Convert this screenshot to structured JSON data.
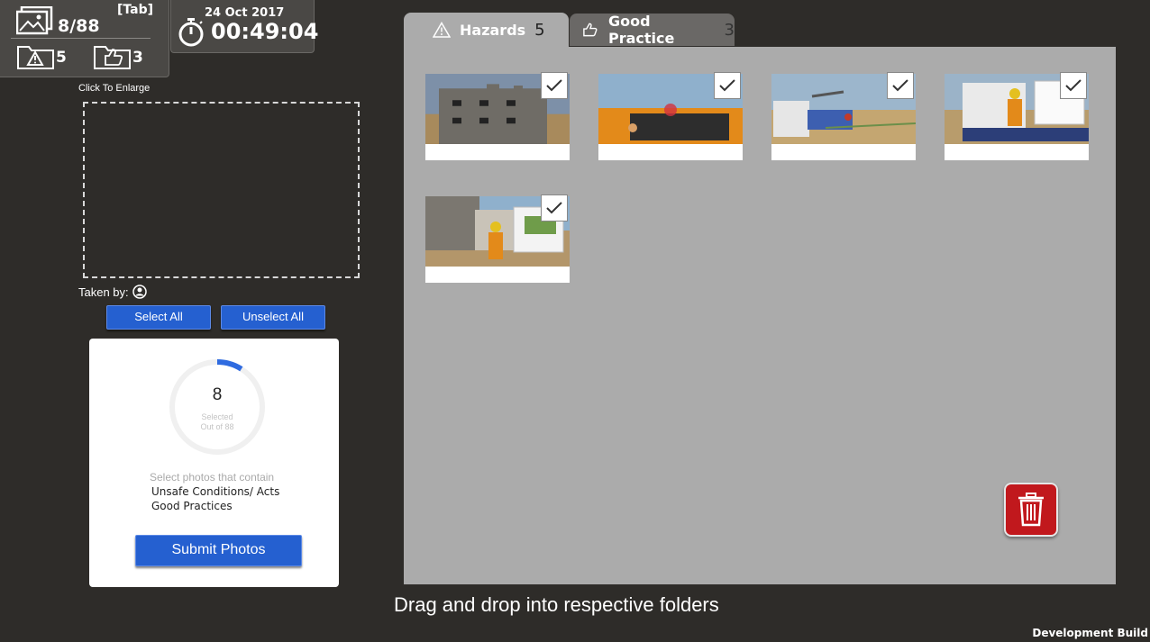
{
  "hud": {
    "photos_count": "8/88",
    "tab_hint": "[Tab]",
    "hazard_folder_count": "5",
    "good_folder_count": "3",
    "date": "24 Oct 2017",
    "timer": "00:49:04"
  },
  "left": {
    "enlarge_label": "Click To Enlarge",
    "taken_by_label": "Taken by:",
    "select_all": "Select All",
    "unselect_all": "Unselect All"
  },
  "card": {
    "selected_count": "8",
    "selected_label": "Selected",
    "out_of_label": "Out of 88",
    "progress_fraction": 0.09,
    "instruction": "Select photos that contain",
    "item1": "Unsafe Conditions/ Acts",
    "item2": "Good Practices",
    "submit": "Submit Photos"
  },
  "tabs": [
    {
      "label": "Hazards",
      "count": "5",
      "icon": "warning-icon",
      "active": true
    },
    {
      "label": "Good Practice",
      "count": "3",
      "icon": "thumbs-up-icon",
      "active": false
    }
  ],
  "photos": [
    {
      "name": "building-structure",
      "checked": true
    },
    {
      "name": "orange-vehicle",
      "checked": true
    },
    {
      "name": "truck-crane-worker",
      "checked": true
    },
    {
      "name": "truck-worker-notice",
      "checked": true
    },
    {
      "name": "worker-notice-board",
      "checked": true
    }
  ],
  "footer": {
    "instruction": "Drag and drop into respective folders",
    "dev_build": "Development Build"
  },
  "colors": {
    "background": "#2e2c29",
    "accent_blue": "#2560d0",
    "trash_red": "#c1181d",
    "panel_gray": "#ababab"
  }
}
